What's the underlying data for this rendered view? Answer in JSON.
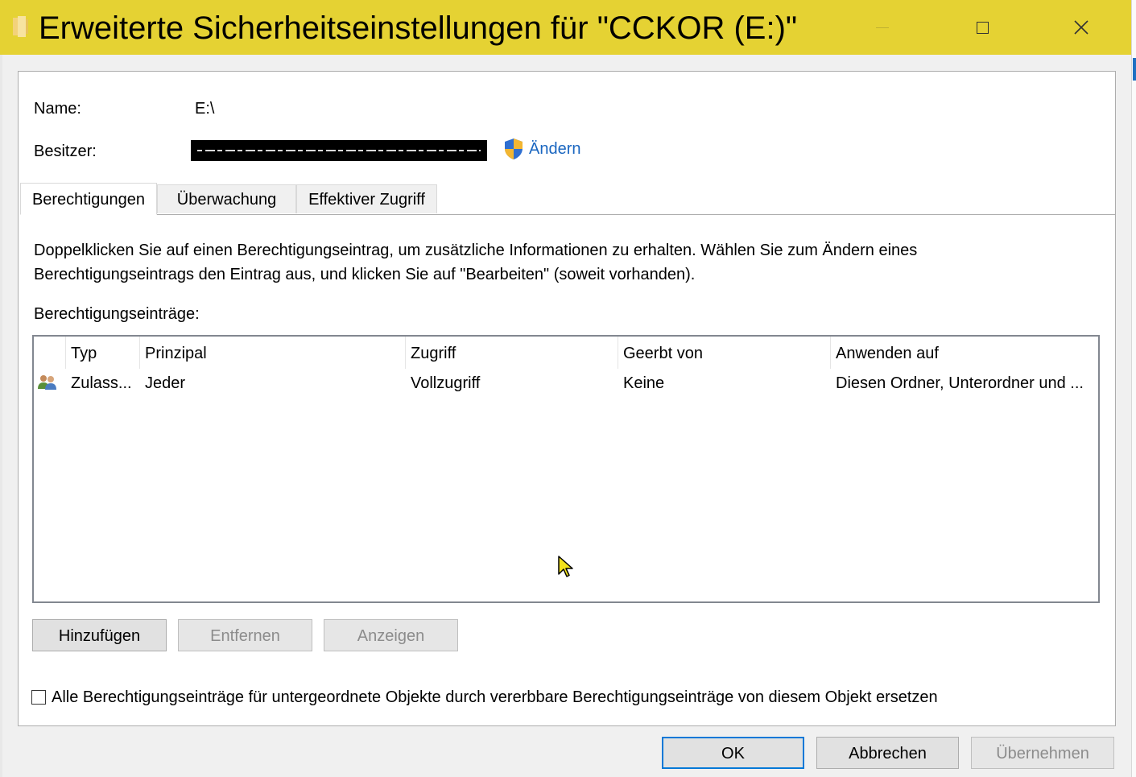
{
  "window": {
    "title": "Erweiterte Sicherheitseinstellungen für \"CCKOR (E:)\"",
    "title_bar_color": "#e5d233"
  },
  "icons": {
    "title": "folder-icon",
    "shield": "uac-shield-icon",
    "user_group": "users-icon",
    "minimize": "minimize-icon",
    "maximize": "maximize-icon",
    "close": "close-icon",
    "cursor": "mouse-pointer-icon"
  },
  "info": {
    "name_label": "Name:",
    "name_value": "E:\\",
    "owner_label": "Besitzer:",
    "change_link": "Ändern",
    "link_color": "#1a66c0"
  },
  "tabs": [
    {
      "label": "Berechtigungen",
      "active": true
    },
    {
      "label": "Überwachung",
      "active": false
    },
    {
      "label": "Effektiver Zugriff",
      "active": false
    }
  ],
  "description": {
    "line1": "Doppelklicken Sie auf einen Berechtigungseintrag, um zusätzliche Informationen zu erhalten. Wählen Sie zum Ändern eines",
    "line2": "Berechtigungseintrags den Eintrag aus, und klicken Sie auf \"Bearbeiten\" (soweit vorhanden)."
  },
  "entries_label": "Berechtigungseinträge:",
  "table": {
    "columns": [
      "Typ",
      "Prinzipal",
      "Zugriff",
      "Geerbt von",
      "Anwenden auf"
    ],
    "rows": [
      {
        "typ": "Zulass...",
        "prinzipal": "Jeder",
        "zugriff": "Vollzugriff",
        "geerbt_von": "Keine",
        "anwenden_auf": "Diesen Ordner, Unterordner und ..."
      }
    ]
  },
  "buttons": {
    "add": "Hinzufügen",
    "remove": "Entfernen",
    "view": "Anzeigen",
    "ok": "OK",
    "cancel": "Abbrechen",
    "apply": "Übernehmen"
  },
  "replace_checkbox": {
    "label": "Alle Berechtigungseinträge für untergeordnete Objekte durch vererbbare Berechtigungseinträge von diesem Objekt ersetzen",
    "checked": false
  }
}
